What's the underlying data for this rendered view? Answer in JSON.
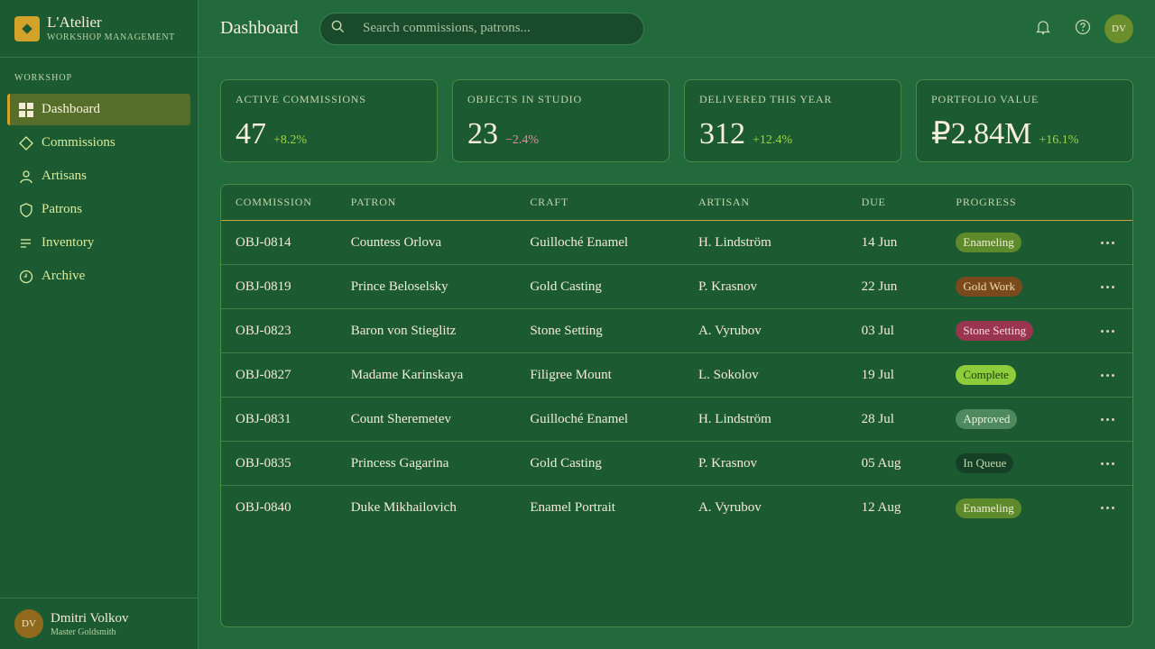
{
  "brand": {
    "name": "L'Atelier",
    "sub": "WORKSHOP MANAGEMENT"
  },
  "sidebar": {
    "section": "WORKSHOP",
    "items": [
      {
        "label": "Dashboard",
        "icon": "grid-icon"
      },
      {
        "label": "Commissions",
        "icon": "diamond-icon"
      },
      {
        "label": "Artisans",
        "icon": "person-icon"
      },
      {
        "label": "Patrons",
        "icon": "shield-icon"
      },
      {
        "label": "Inventory",
        "icon": "list-icon"
      },
      {
        "label": "Archive",
        "icon": "clock-icon"
      }
    ],
    "active_index": 0
  },
  "user": {
    "initials": "DV",
    "name": "Dmitri Volkov",
    "role": "Master Goldsmith"
  },
  "header": {
    "title": "Dashboard",
    "search_placeholder": "Search commissions, patrons...",
    "avatar_initials": "DV"
  },
  "kpis": [
    {
      "label": "Active Commissions",
      "value": "47",
      "delta": "+8.2%",
      "trend": "up"
    },
    {
      "label": "Objects in Studio",
      "value": "23",
      "delta": "−2.4%",
      "trend": "down"
    },
    {
      "label": "Delivered This Year",
      "value": "312",
      "delta": "+12.4%",
      "trend": "up"
    },
    {
      "label": "Portfolio Value",
      "value": "₽2.84M",
      "delta": "+16.1%",
      "trend": "up"
    }
  ],
  "table": {
    "columns": [
      "Commission",
      "Patron",
      "Craft",
      "Artisan",
      "Due",
      "Progress"
    ],
    "rows": [
      {
        "id": "OBJ-0814",
        "patron": "Countess Orlova",
        "craft": "Guilloché Enamel",
        "artisan": "H. Lindström",
        "due": "14 Jun",
        "status": "Enameling"
      },
      {
        "id": "OBJ-0819",
        "patron": "Prince Beloselsky",
        "craft": "Gold Casting",
        "artisan": "P. Krasnov",
        "due": "22 Jun",
        "status": "Gold Work"
      },
      {
        "id": "OBJ-0823",
        "patron": "Baron von Stieglitz",
        "craft": "Stone Setting",
        "artisan": "A. Vyrubov",
        "due": "03 Jul",
        "status": "Stone Setting"
      },
      {
        "id": "OBJ-0827",
        "patron": "Madame Karinskaya",
        "craft": "Filigree Mount",
        "artisan": "L. Sokolov",
        "due": "19 Jul",
        "status": "Complete"
      },
      {
        "id": "OBJ-0831",
        "patron": "Count Sheremetev",
        "craft": "Guilloché Enamel",
        "artisan": "H. Lindström",
        "due": "28 Jul",
        "status": "Approved"
      },
      {
        "id": "OBJ-0835",
        "patron": "Princess Gagarina",
        "craft": "Gold Casting",
        "artisan": "P. Krasnov",
        "due": "05 Aug",
        "status": "In Queue"
      },
      {
        "id": "OBJ-0840",
        "patron": "Duke Mikhailovich",
        "craft": "Enamel Portrait",
        "artisan": "A. Vyrubov",
        "due": "12 Aug",
        "status": "Enameling"
      }
    ]
  },
  "colors": {
    "accent": "#d2a22a",
    "background": "#226a3c",
    "positive": "#9fd447",
    "negative": "#e58aa1"
  }
}
